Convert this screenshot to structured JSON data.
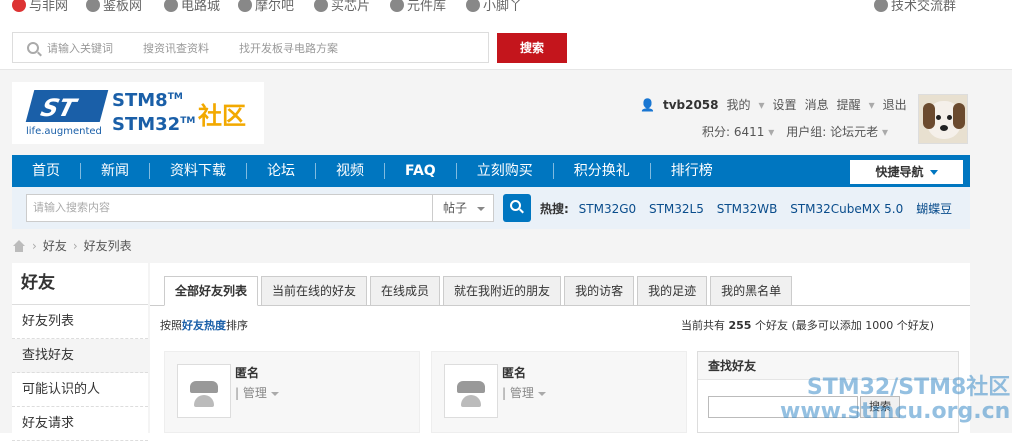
{
  "sitebar": {
    "items": [
      {
        "label": "与非网",
        "icon": "yufei-logo-icon"
      },
      {
        "label": "鉴板网",
        "icon": "board-icon"
      },
      {
        "label": "电路城",
        "icon": "circuit-icon"
      },
      {
        "label": "摩尔吧",
        "icon": "moore-icon"
      },
      {
        "label": "买芯片",
        "icon": "chip-icon"
      },
      {
        "label": "元件库",
        "icon": "component-icon"
      },
      {
        "label": "小脚丫",
        "icon": "foot-icon"
      }
    ],
    "tech_group": "技术交流群"
  },
  "top_search": {
    "placeholder_1": "请输入关键词",
    "placeholder_2": "搜资讯查资料",
    "placeholder_3": "找开发板寻电路方案",
    "button": "搜索"
  },
  "brand": {
    "st_letters": "ST",
    "tagline": "life.augmented",
    "line1": "STM8",
    "line2": "STM32",
    "tm": "TM",
    "community": "社区"
  },
  "user": {
    "name": "tvb2058",
    "menu": [
      "我的",
      "设置",
      "消息",
      "提醒",
      "退出"
    ],
    "points_label": "积分: 6411",
    "group_label": "用户组: 论坛元老"
  },
  "nav": {
    "items": [
      "首页",
      "新闻",
      "资料下载",
      "论坛",
      "视频",
      "FAQ",
      "立刻购买",
      "积分换礼",
      "排行榜"
    ],
    "quick": "快捷导航"
  },
  "sub_search": {
    "placeholder": "请输入搜索内容",
    "scope": "帖子",
    "hot_label": "热搜:",
    "hot": [
      "STM32G0",
      "STM32L5",
      "STM32WB",
      "STM32CubeMX 5.0",
      "蝴蝶豆"
    ]
  },
  "breadcrumb": [
    "好友",
    "好友列表"
  ],
  "sidebar": {
    "title": "好友",
    "items": [
      "好友列表",
      "查找好友",
      "可能认识的人",
      "好友请求"
    ]
  },
  "tabs": [
    "全部好友列表",
    "当前在线的好友",
    "在线成员",
    "就在我附近的朋友",
    "我的访客",
    "我的足迹",
    "我的黑名单"
  ],
  "sort": {
    "prefix": "按照",
    "key": "好友热度",
    "suffix": "排序"
  },
  "count": {
    "prefix": "当前共有",
    "value": "255",
    "suffix": "个好友 (最多可以添加 1000 个好友)"
  },
  "friends": [
    {
      "name": "匿名",
      "manage": "管理"
    },
    {
      "name": "匿名",
      "manage": "管理"
    }
  ],
  "find_friend": {
    "title": "查找好友",
    "button": "搜索"
  },
  "watermark": {
    "line1": "STM32/STM8社区",
    "line2": "www.stmcu.org.cn"
  },
  "colors": {
    "nav": "#0076c0",
    "search_button": "#c4151c",
    "brand_blue": "#1a5fa8",
    "community_orange": "#f2a900"
  }
}
